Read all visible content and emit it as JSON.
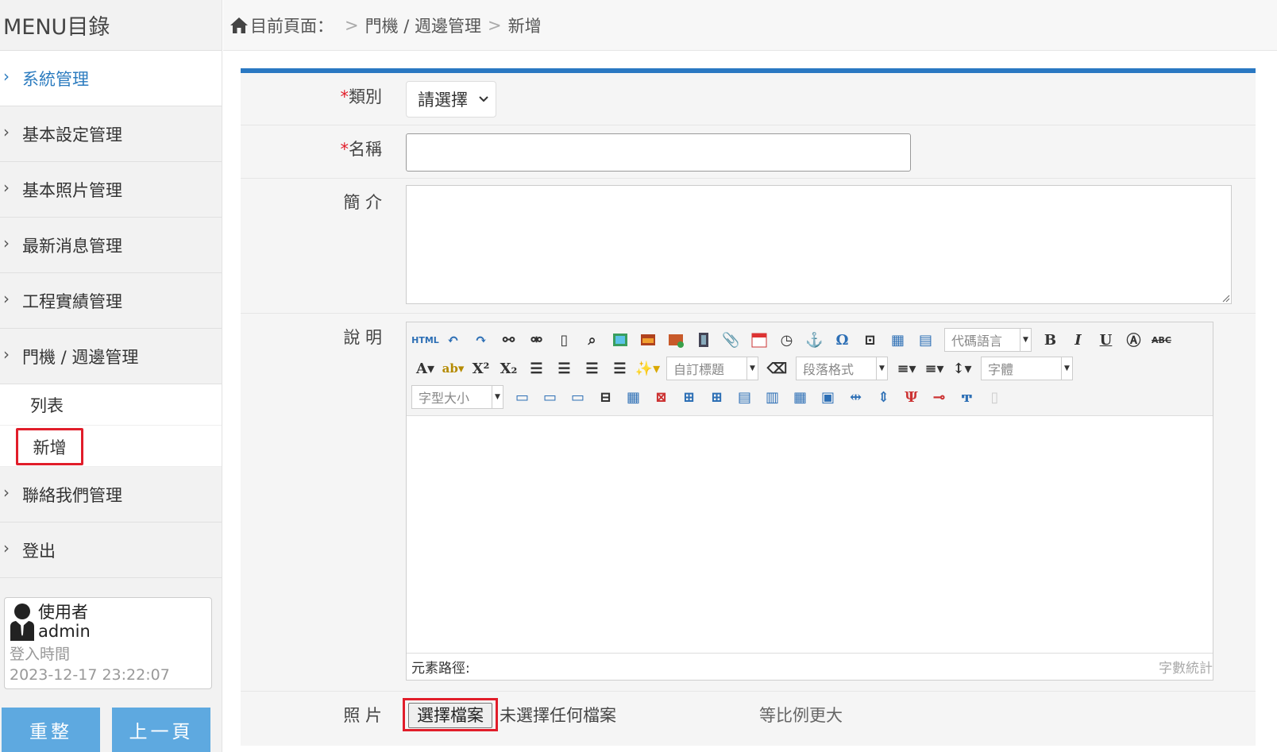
{
  "sidebar": {
    "title": "MENU目錄",
    "items": [
      {
        "label": "系統管理"
      },
      {
        "label": "基本設定管理"
      },
      {
        "label": "基本照片管理"
      },
      {
        "label": "最新消息管理"
      },
      {
        "label": "工程實績管理"
      },
      {
        "label": "門機 / 週邊管理"
      }
    ],
    "sub_items": [
      {
        "label": "列表"
      },
      {
        "label": "新增"
      }
    ],
    "items_after": [
      {
        "label": "聯絡我們管理"
      },
      {
        "label": "登出"
      }
    ],
    "user": {
      "role": "使用者",
      "name": "admin",
      "login_label": "登入時間",
      "login_time": "2023-12-17 23:22:07"
    },
    "buttons": {
      "reset": "重整",
      "back": "上一頁"
    }
  },
  "breadcrumb": {
    "label": "目前頁面：",
    "items": [
      "門機 / 週邊管理",
      "新增"
    ]
  },
  "form": {
    "category": {
      "required": "*",
      "label": "類別",
      "value": "請選擇"
    },
    "name": {
      "required": "*",
      "label": "名稱",
      "value": ""
    },
    "intro": {
      "label": "簡 介",
      "value": ""
    },
    "description": {
      "label": "說 明",
      "toolbar": {
        "code_lang": "代碼語言",
        "custom_title": "自訂標題",
        "paragraph": "段落格式",
        "font": "字體",
        "font_size": "字型大小",
        "html": "HTML"
      },
      "status_path": "元素路徑:",
      "word_count": "字數統計"
    },
    "photo": {
      "label": "照 片",
      "choose_button": "選擇檔案",
      "no_file": "未選擇任何檔案",
      "note": "等比例更大"
    }
  },
  "colors": {
    "accent": "#2a78c2",
    "button": "#5ea9e0",
    "highlight": "#e11d2a"
  }
}
